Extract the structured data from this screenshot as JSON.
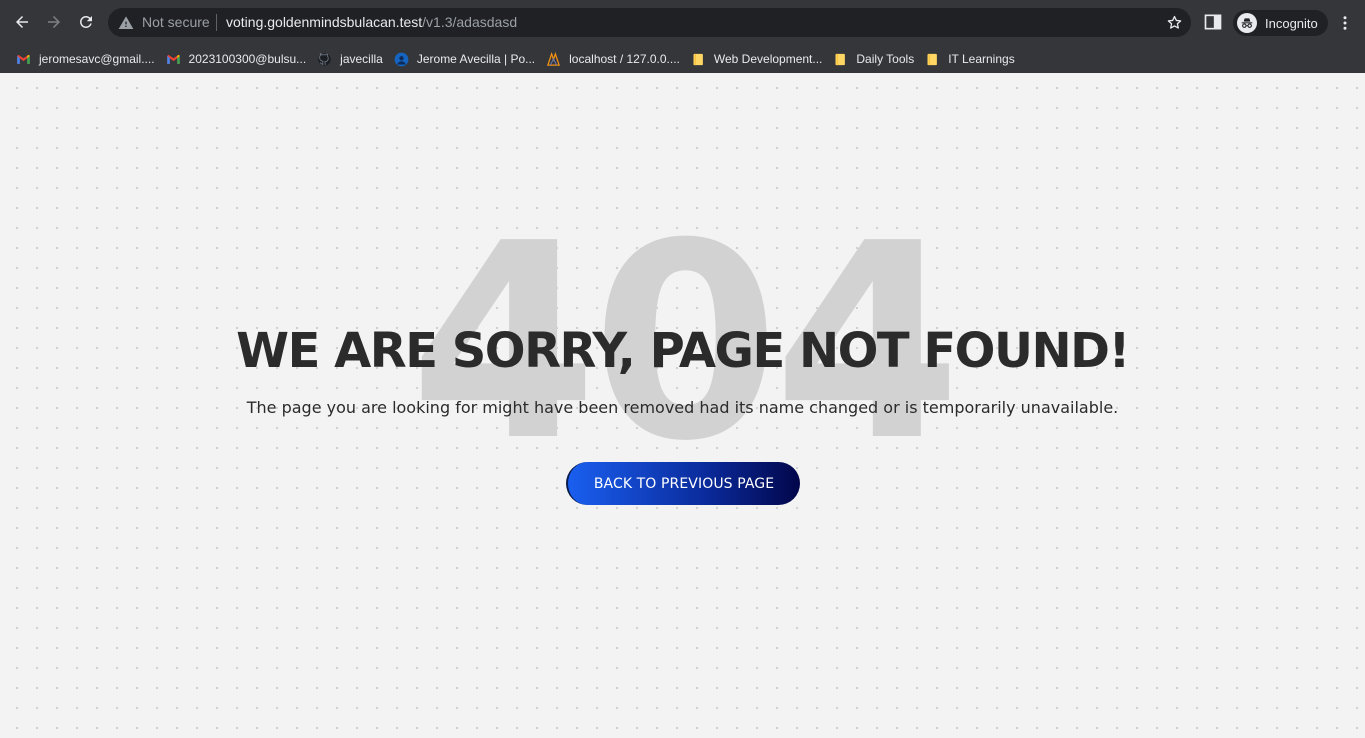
{
  "browser": {
    "omnibox": {
      "security_label": "Not secure",
      "url_host": "voting.goldenmindsbulacan.test",
      "url_path": "/v1.3/adasdasd"
    },
    "profile_label": "Incognito",
    "bookmarks": [
      {
        "label": "jeromesavc@gmail....",
        "icon": "gmail-icon"
      },
      {
        "label": "2023100300@bulsu...",
        "icon": "gmail-icon"
      },
      {
        "label": "javecilla",
        "icon": "github-icon"
      },
      {
        "label": "Jerome Avecilla | Po...",
        "icon": "portfolio-icon"
      },
      {
        "label": "localhost / 127.0.0....",
        "icon": "phpmyadmin-icon"
      },
      {
        "label": "Web Development...",
        "icon": "folder-icon"
      },
      {
        "label": "Daily Tools",
        "icon": "folder-icon"
      },
      {
        "label": "IT Learnings",
        "icon": "folder-icon"
      }
    ]
  },
  "page": {
    "background_code": "404",
    "headline": "WE ARE SORRY, PAGE NOT FOUND!",
    "message": "The page you are looking for might have been removed had its name changed or is temporarily unavailable.",
    "back_button_label": "BACK TO PREVIOUS PAGE"
  },
  "colors": {
    "chrome_bg": "#35363a",
    "omnibox_bg": "#202124",
    "page_bg": "#f3f3f3",
    "button_start": "#1a5ff0",
    "button_end": "#02064a",
    "headline_text": "#2b2b2b",
    "ghost_404": "#d2d2d2"
  }
}
